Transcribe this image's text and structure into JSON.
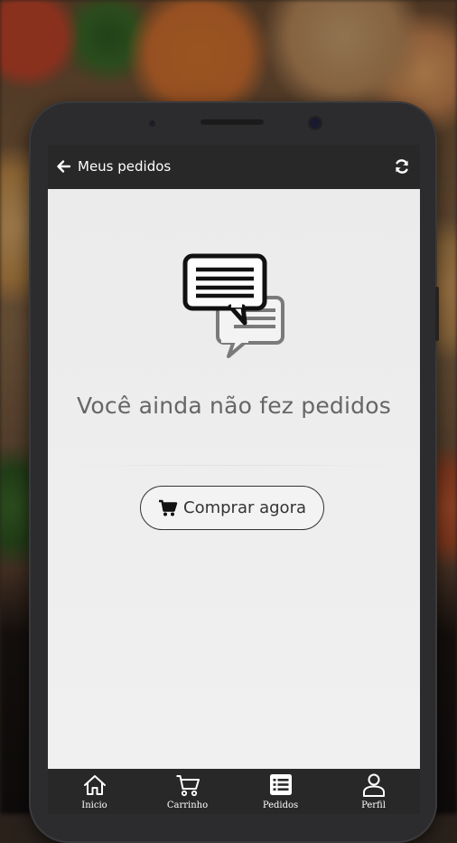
{
  "appbar": {
    "title": "Meus pedidos",
    "back_icon": "arrow-left-icon",
    "refresh_icon": "refresh-icon"
  },
  "empty_state": {
    "icon": "chat-bubbles-icon",
    "message": "Você ainda não fez pedidos",
    "button_label": "Comprar agora",
    "button_icon": "shopping-cart-icon"
  },
  "bottom_nav": {
    "items": [
      {
        "label": "Inicio",
        "icon": "home-icon"
      },
      {
        "label": "Carrinho",
        "icon": "cart-icon"
      },
      {
        "label": "Pedidos",
        "icon": "list-icon"
      },
      {
        "label": "Perfil",
        "icon": "user-icon"
      }
    ]
  },
  "colors": {
    "appbar": "#282828",
    "screen_bg": "#ececec",
    "text_muted": "#666666"
  }
}
